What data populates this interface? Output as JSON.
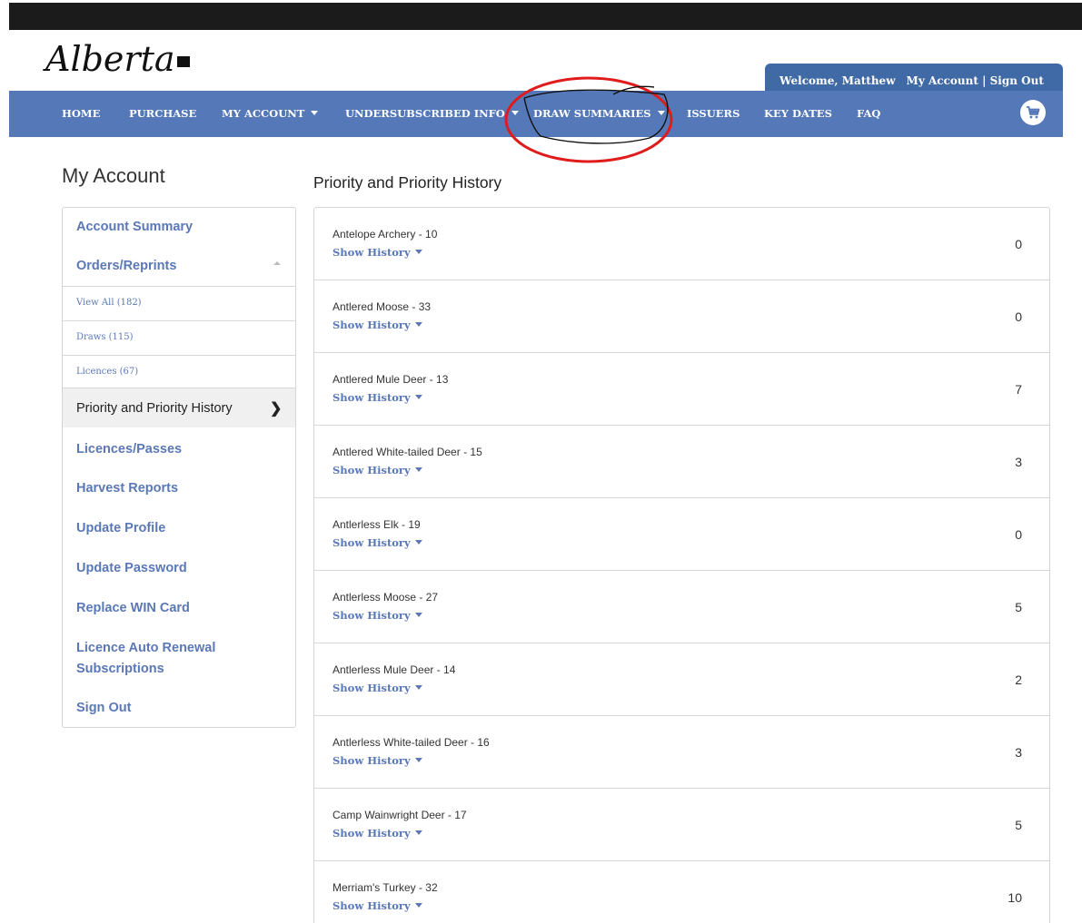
{
  "header": {
    "logo_text": "Alberta",
    "welcome_text": "Welcome, Matthew",
    "my_account_link": "My Account",
    "separator": "|",
    "sign_out_link": "Sign Out"
  },
  "nav": {
    "items": [
      {
        "label": "HOME",
        "dropdown": false
      },
      {
        "label": "PURCHASE",
        "dropdown": false
      },
      {
        "label": "MY ACCOUNT",
        "dropdown": true
      },
      {
        "label": "UNDERSUBSCRIBED INFO",
        "dropdown": true
      },
      {
        "label": "DRAW SUMMARIES",
        "dropdown": true
      },
      {
        "label": "ISSUERS",
        "dropdown": false
      },
      {
        "label": "KEY DATES",
        "dropdown": false
      },
      {
        "label": "FAQ",
        "dropdown": false
      }
    ],
    "cart_icon": "cart-icon",
    "annotation_color": "#e01b1b"
  },
  "sidebar": {
    "title": "My Account",
    "account_summary": "Account Summary",
    "orders_reprints": "Orders/Reprints",
    "sub_items": [
      "View All (182)",
      "Draws (115)",
      "Licences (67)"
    ],
    "active_item": "Priority and Priority History",
    "links": [
      "Licences/Passes",
      "Harvest Reports",
      "Update Profile",
      "Update Password",
      "Replace WIN Card",
      "Licence Auto Renewal",
      "Subscriptions",
      "Sign Out"
    ]
  },
  "main": {
    "title": "Priority and Priority History",
    "show_history_label": "Show History",
    "rows": [
      {
        "name": "Antelope Archery - 10",
        "value": "0"
      },
      {
        "name": "Antlered Moose - 33",
        "value": "0"
      },
      {
        "name": "Antlered Mule Deer - 13",
        "value": "7"
      },
      {
        "name": "Antlered White-tailed Deer - 15",
        "value": "3"
      },
      {
        "name": "Antlerless Elk - 19",
        "value": "0"
      },
      {
        "name": "Antlerless Moose - 27",
        "value": "5"
      },
      {
        "name": "Antlerless Mule Deer - 14",
        "value": "2"
      },
      {
        "name": "Antlerless White-tailed Deer - 16",
        "value": "3"
      },
      {
        "name": "Camp Wainwright Deer - 17",
        "value": "5"
      },
      {
        "name": "Merriam's Turkey - 32",
        "value": "10"
      }
    ]
  },
  "colors": {
    "nav_bar": "#5478b8",
    "welcome_tab": "#3f6aa6",
    "link": "#5b78b6"
  }
}
